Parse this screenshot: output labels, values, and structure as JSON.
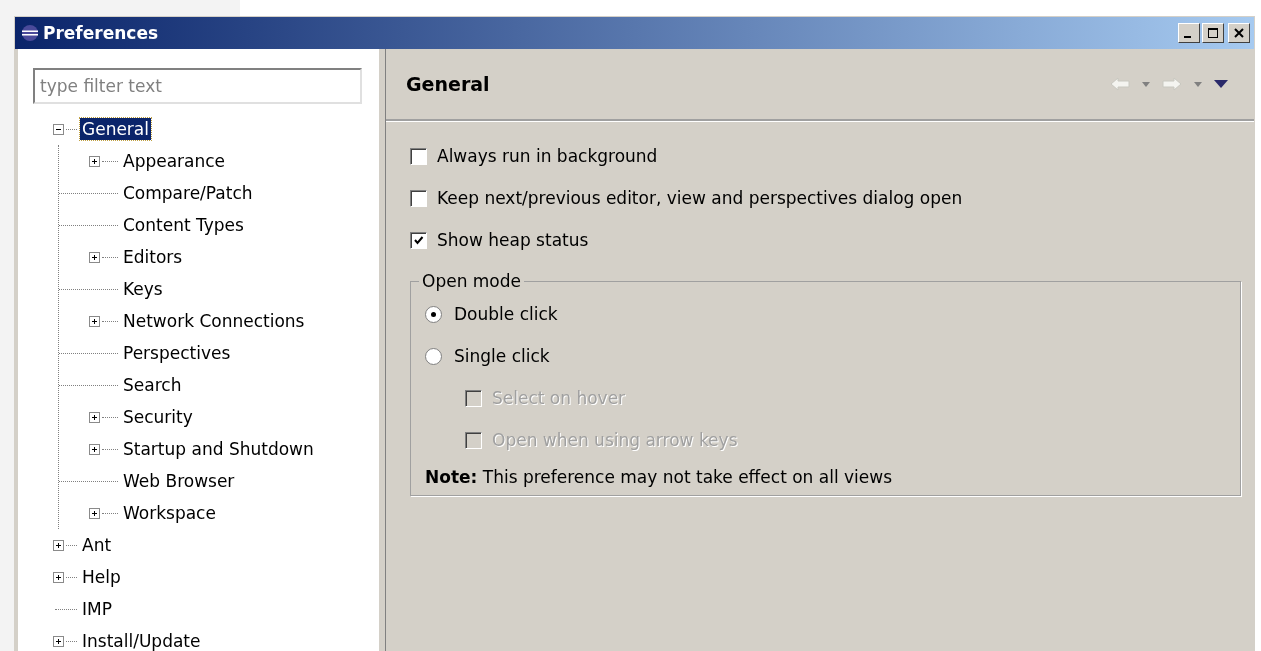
{
  "window": {
    "title": "Preferences"
  },
  "filter": {
    "placeholder": "type filter text"
  },
  "tree": [
    {
      "label": "General",
      "kind": "folder",
      "expanded": true,
      "selected": true,
      "children": [
        {
          "label": "Appearance",
          "kind": "folder",
          "expanded": false,
          "selected": false
        },
        {
          "label": "Compare/Patch",
          "kind": "leaf",
          "selected": false
        },
        {
          "label": "Content Types",
          "kind": "leaf",
          "selected": false
        },
        {
          "label": "Editors",
          "kind": "folder",
          "expanded": false,
          "selected": false
        },
        {
          "label": "Keys",
          "kind": "leaf",
          "selected": false
        },
        {
          "label": "Network Connections",
          "kind": "folder",
          "expanded": false,
          "selected": false
        },
        {
          "label": "Perspectives",
          "kind": "leaf",
          "selected": false
        },
        {
          "label": "Search",
          "kind": "leaf",
          "selected": false
        },
        {
          "label": "Security",
          "kind": "folder",
          "expanded": false,
          "selected": false
        },
        {
          "label": "Startup and Shutdown",
          "kind": "folder",
          "expanded": false,
          "selected": false
        },
        {
          "label": "Web Browser",
          "kind": "leaf",
          "selected": false
        },
        {
          "label": "Workspace",
          "kind": "folder",
          "expanded": false,
          "selected": false
        }
      ]
    },
    {
      "label": "Ant",
      "kind": "folder",
      "expanded": false,
      "selected": false
    },
    {
      "label": "Help",
      "kind": "folder",
      "expanded": false,
      "selected": false
    },
    {
      "label": "IMP",
      "kind": "leaf",
      "selected": false
    },
    {
      "label": "Install/Update",
      "kind": "folder",
      "expanded": false,
      "selected": false
    }
  ],
  "page": {
    "title": "General",
    "options": [
      {
        "label": "Always run in background",
        "checked": false
      },
      {
        "label": "Keep next/previous editor, view and perspectives dialog open",
        "checked": false
      },
      {
        "label": "Show heap status",
        "checked": true
      }
    ],
    "open_mode": {
      "title": "Open mode",
      "choices": [
        {
          "label": "Double click",
          "selected": true
        },
        {
          "label": "Single click",
          "selected": false
        }
      ],
      "sub_options": [
        {
          "label": "Select on hover",
          "checked": false,
          "disabled": true
        },
        {
          "label": "Open when using arrow keys",
          "checked": false,
          "disabled": true
        }
      ],
      "note": "**Note:** This preference may not take effect on all views"
    }
  }
}
